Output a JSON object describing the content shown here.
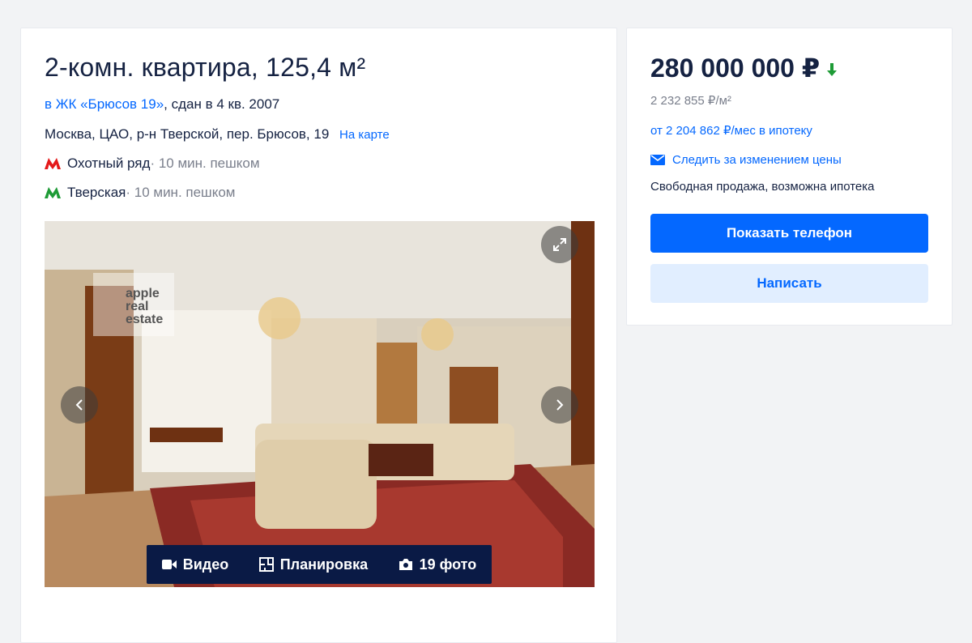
{
  "listing": {
    "title": "2-комн. квартира, 125,4 м²",
    "jk_link": "в ЖК «Брюсов 19»",
    "jk_suffix": ", сдан в 4 кв. 2007",
    "address": "Москва, ЦАО, р-н Тверской, пер. Брюсов, 19",
    "map_link": "На карте",
    "metro": [
      {
        "station": "Охотный ряд",
        "walk": " · 10 мин. пешком",
        "color": "#e4191a"
      },
      {
        "station": "Тверская",
        "walk": " · 10 мин. пешком",
        "color": "#1e9b36"
      }
    ]
  },
  "gallery": {
    "watermark": "apple real estate",
    "video_label": "Видео",
    "plan_label": "Планировка",
    "photos_label": "19 фото",
    "icons": [
      "expand-icon",
      "chevron-left-icon",
      "chevron-right-icon",
      "video-icon",
      "floorplan-icon",
      "camera-icon"
    ]
  },
  "sidebar": {
    "price": "280 000 000 ₽",
    "price_per_m2": "2 232 855 ₽/м²",
    "mortgage": "от 2 204 862 ₽/мес в ипотеку",
    "follow_price": "Следить за изменением цены",
    "sale_type": "Свободная продажа, возможна ипотека",
    "show_phone": "Показать телефон",
    "write": "Написать",
    "accent": "#0468ff",
    "price_down_color": "#1e9b36"
  }
}
